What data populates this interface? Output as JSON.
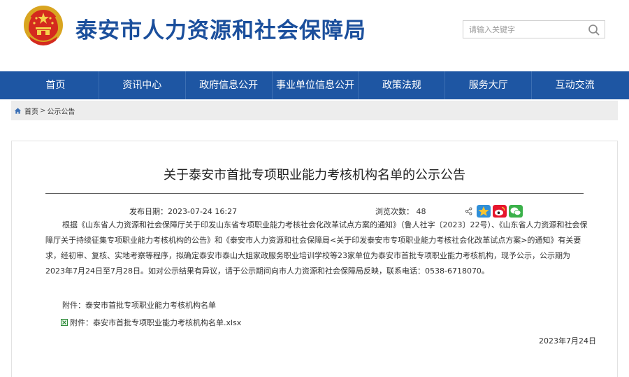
{
  "header": {
    "site_title": "泰安市人力资源和社会保障局",
    "search_placeholder": "请输入关键字"
  },
  "nav": {
    "items": [
      {
        "label": "首页"
      },
      {
        "label": "资讯中心"
      },
      {
        "label": "政府信息公开"
      },
      {
        "label": "事业单位信息公开"
      },
      {
        "label": "政策法规"
      },
      {
        "label": "服务大厅"
      },
      {
        "label": "互动交流"
      }
    ]
  },
  "breadcrumb": {
    "home": "首页",
    "separator": ">",
    "current": "公示公告"
  },
  "article": {
    "title": "关于泰安市首批专项职业能力考核机构名单的公示公告",
    "date_text": "发布日期：2023-07-24 16:27",
    "views_text": "浏览次数： 48",
    "body": "根据《山东省人力资源和社会保障厅关于印发山东省专项职业能力考核社会化改革试点方案的通知》（鲁人社字〔2023〕22号）、《山东省人力资源和社会保障厅关于持续征集专项职业能力考核机构的公告》和《泰安市人力资源和社会保障局<关于印发泰安市专项职业能力考核社会化改革试点方案>的通知》有关要求，经初审、复核、实地考察等程序，拟确定泰安市泰山大姐家政服务职业培训学校等23家单位为泰安市首批专项职业能力考核机构，现予公示，公示期为2023年7月24日至7月28日。如对公示结果有异议，请于公示期间向市人力资源和社会保障局反映，联系电话：0538-6718070。",
    "attachment_label": "附件：泰安市首批专项职业能力考核机构名单",
    "attachment_file": "附件：泰安市首批专项职业能力考核机构名单.xlsx",
    "sign_date": "2023年7月24日"
  },
  "colors": {
    "brand_blue": "#1b4f9c",
    "nav_blue": "#1e56a3",
    "breadcrumb_bg": "#ededed"
  },
  "icons": [
    "emblem-icon",
    "search-icon",
    "home-icon",
    "share-icon",
    "qzone-icon",
    "weibo-icon",
    "wechat-icon",
    "xls-icon"
  ]
}
